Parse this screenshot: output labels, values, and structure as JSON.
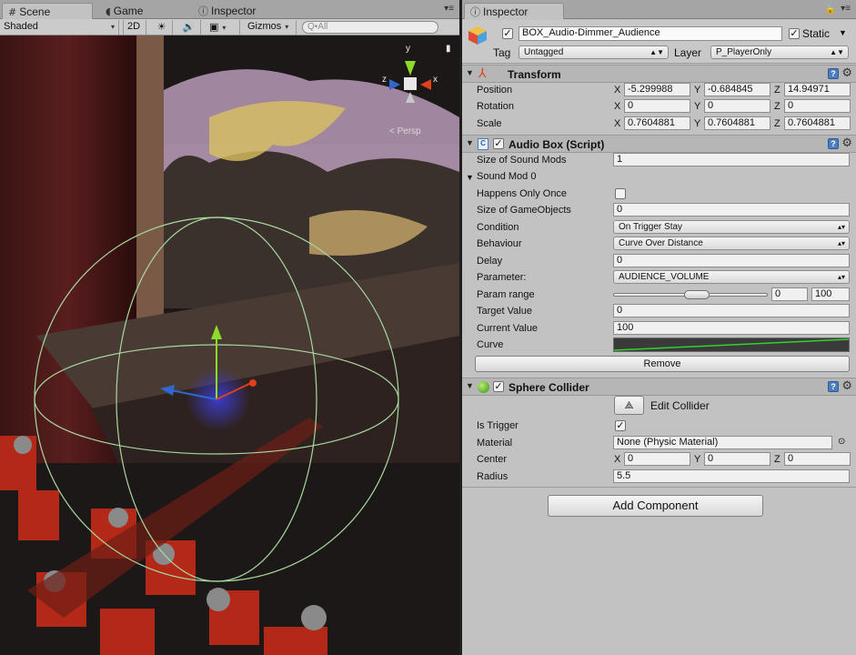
{
  "scene_panel": {
    "tabs": [
      {
        "label": "Scene",
        "glyph": "#",
        "icon": "scene-icon"
      },
      {
        "label": "Game",
        "glyph": "◖",
        "icon": "game-icon"
      },
      {
        "label": "Inspector",
        "glyph": "ⓘ",
        "icon": "info-icon"
      }
    ],
    "toolbar": {
      "shading_mode": "Shaded",
      "mode_2d": "2D",
      "lighting_icon": "sun-icon",
      "audio_icon": "speaker-icon",
      "effects_icon": "image-icon",
      "gizmos": "Gizmos",
      "search_placeholder": "Q•All"
    },
    "persp_label": "< Persp",
    "gizmo_axes": {
      "x": "x",
      "y": "y",
      "z": "z"
    }
  },
  "inspector": {
    "tab_label": "Inspector",
    "tab_icon": "info-icon",
    "object": {
      "active": true,
      "name": "BOX_Audio-Dimmer_Audience",
      "static_label": "Static",
      "static": true,
      "tag_label": "Tag",
      "tag_value": "Untagged",
      "layer_label": "Layer",
      "layer_value": "P_PlayerOnly"
    },
    "transform": {
      "title": "Transform",
      "rows": [
        {
          "label": "Position",
          "x": "-5.299988",
          "y": "-0.684845",
          "z": "14.94971"
        },
        {
          "label": "Rotation",
          "x": "0",
          "y": "0",
          "z": "0"
        },
        {
          "label": "Scale",
          "x": "0.7604881",
          "y": "0.7604881",
          "z": "0.7604881"
        }
      ]
    },
    "audio_box": {
      "title": "Audio Box (Script)",
      "enabled": true,
      "size_of_sound_mods_label": "Size of Sound Mods",
      "size_of_sound_mods": "1",
      "sound_mod_label": "Sound Mod 0",
      "happens_only_once_label": "Happens Only Once",
      "happens_only_once": false,
      "size_of_gameobjects_label": "Size of GameObjects",
      "size_of_gameobjects": "0",
      "condition_label": "Condition",
      "condition": "On Trigger Stay",
      "behaviour_label": "Behaviour",
      "behaviour": "Curve Over Distance",
      "delay_label": "Delay",
      "delay": "0",
      "parameter_label": "Parameter:",
      "parameter": "AUDIENCE_VOLUME",
      "param_range_label": "Param range",
      "param_range_min": "0",
      "param_range_max": "100",
      "target_value_label": "Target Value",
      "target_value": "0",
      "current_value_label": "Current Value",
      "current_value": "100",
      "curve_label": "Curve",
      "curve_color": "#2fd22f",
      "remove_label": "Remove"
    },
    "sphere_collider": {
      "title": "Sphere Collider",
      "enabled": true,
      "edit_collider_label": "Edit Collider",
      "is_trigger_label": "Is Trigger",
      "is_trigger": true,
      "material_label": "Material",
      "material": "None (Physic Material)",
      "center_label": "Center",
      "center": {
        "x": "0",
        "y": "0",
        "z": "0"
      },
      "radius_label": "Radius",
      "radius": "5.5"
    },
    "add_component_label": "Add Component"
  },
  "colors": {
    "accent": "#4d7dbe",
    "panel": "#c2c2c2",
    "header": "#b6b6b6"
  }
}
